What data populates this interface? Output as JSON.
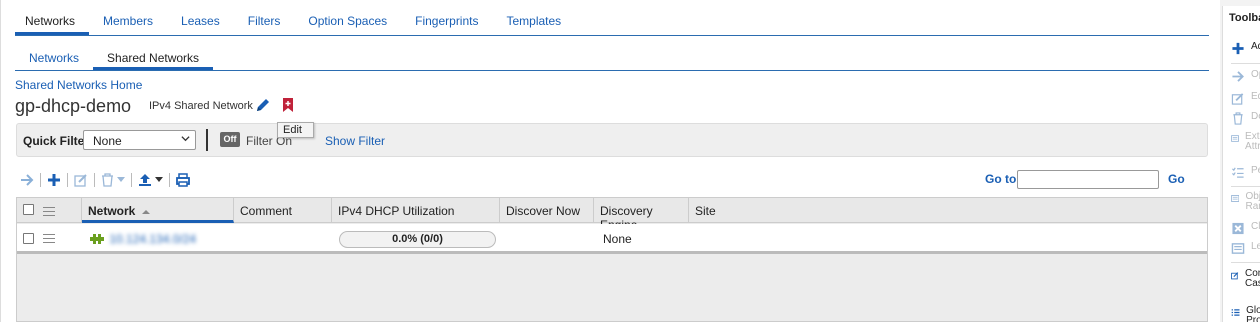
{
  "tabs": [
    {
      "label": "Networks",
      "active": true
    },
    {
      "label": "Members"
    },
    {
      "label": "Leases"
    },
    {
      "label": "Filters"
    },
    {
      "label": "Option Spaces"
    },
    {
      "label": "Fingerprints"
    },
    {
      "label": "Templates"
    }
  ],
  "subtabs": [
    {
      "label": "Networks"
    },
    {
      "label": "Shared Networks",
      "active": true
    }
  ],
  "breadcrumb": "Shared Networks Home",
  "page_title": "gp-dhcp-demo",
  "network_type": "IPv4 Shared Network",
  "tooltip": "Edit",
  "filter": {
    "quick_filter_label": "Quick Filter",
    "quick_filter_value": "None",
    "toggle_label": "Off",
    "filter_on_label": "Filter On",
    "show_filter_label": "Show Filter"
  },
  "goto": {
    "label": "Go to",
    "value": "",
    "go_label": "Go"
  },
  "grid": {
    "columns": [
      "Network",
      "Comment",
      "IPv4 DHCP Utilization",
      "Discover Now",
      "Discovery Engine",
      "Site"
    ],
    "sort_column": "Network",
    "rows": [
      {
        "network": "10.124.134.0/24",
        "comment": "",
        "utilization": "0.0% (0/0)",
        "discover_now": "",
        "discovery_engine": "None",
        "site": ""
      }
    ]
  },
  "toolbar": {
    "title": "Toolbar",
    "items": [
      {
        "label": "Add",
        "icon": "plus-icon",
        "enabled": true
      },
      {
        "label": "Open",
        "icon": "arrow-right-icon",
        "enabled": false
      },
      {
        "label": "Edit",
        "icon": "edit-icon",
        "enabled": false
      },
      {
        "label": "Delete",
        "icon": "trash-icon",
        "enabled": false
      },
      {
        "label": "Extensible Attributes",
        "icon": "list-icon",
        "enabled": false
      },
      {
        "label": "Permissions",
        "icon": "checklist-icon",
        "enabled": false
      },
      {
        "label": "Object Ranges",
        "icon": "grid-icon",
        "enabled": false
      },
      {
        "label": "Clear",
        "icon": "clear-icon",
        "enabled": false
      },
      {
        "label": "Leases",
        "icon": "leases-icon",
        "enabled": false
      },
      {
        "label": "Configure Cascading",
        "icon": "config-icon",
        "enabled": true
      },
      {
        "label": "Global Properties",
        "icon": "bullets-icon",
        "enabled": true
      }
    ]
  },
  "colors": {
    "link": "#1a5fb4",
    "green_icon": "#6a9f1f",
    "bookmark": "#c0223a"
  }
}
